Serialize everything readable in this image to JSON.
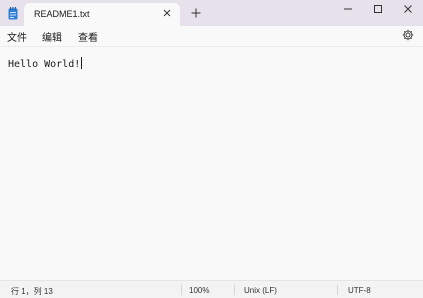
{
  "tab": {
    "title": "README1.txt",
    "close_icon": "close-icon",
    "new_tab_icon": "plus-icon"
  },
  "window_controls": {
    "minimize_icon": "minimize-icon",
    "maximize_icon": "maximize-icon",
    "close_icon": "close-icon"
  },
  "menu": {
    "items": [
      "文件",
      "编辑",
      "查看"
    ],
    "settings_icon": "gear-icon"
  },
  "editor": {
    "content": "Hello World!"
  },
  "status": {
    "position": "行 1，列 13",
    "zoom": "100%",
    "line_ending": "Unix (LF)",
    "encoding": "UTF-8"
  },
  "colors": {
    "titlebar": "#e6e1ea",
    "editor_bg": "#f9f9f9",
    "app_icon": "#2f7fd6"
  }
}
